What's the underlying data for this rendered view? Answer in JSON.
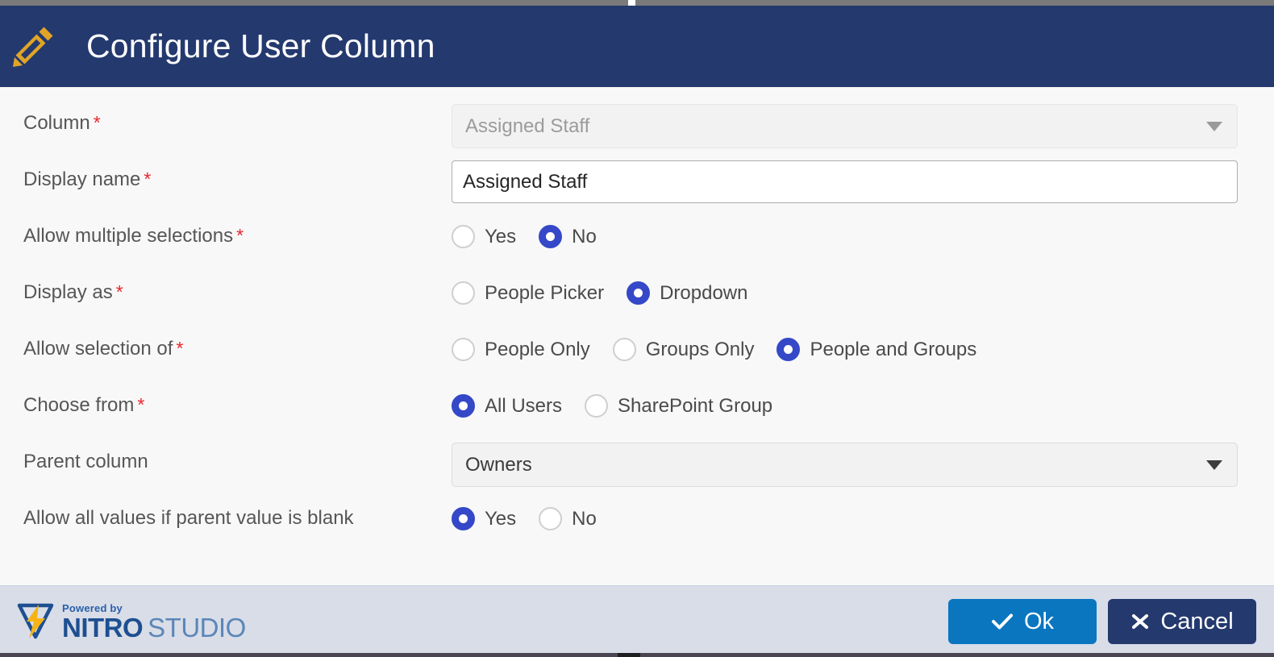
{
  "header": {
    "title": "Configure User Column",
    "icon": "pencil-icon",
    "bg_color": "#24396e",
    "icon_color": "#e0a526"
  },
  "form": {
    "rows": [
      {
        "label": "Column",
        "required": true,
        "control": "select",
        "value": "Assigned Staff",
        "disabled": true
      },
      {
        "label": "Display name",
        "required": true,
        "control": "text",
        "value": "Assigned Staff"
      },
      {
        "label": "Allow multiple selections",
        "required": true,
        "control": "radio",
        "options": [
          {
            "label": "Yes",
            "selected": false
          },
          {
            "label": "No",
            "selected": true
          }
        ]
      },
      {
        "label": "Display as",
        "required": true,
        "control": "radio",
        "options": [
          {
            "label": "People Picker",
            "selected": false
          },
          {
            "label": "Dropdown",
            "selected": true
          }
        ]
      },
      {
        "label": "Allow selection of",
        "required": true,
        "control": "radio",
        "options": [
          {
            "label": "People Only",
            "selected": false
          },
          {
            "label": "Groups Only",
            "selected": false
          },
          {
            "label": "People and Groups",
            "selected": true
          }
        ]
      },
      {
        "label": "Choose from",
        "required": true,
        "control": "radio",
        "options": [
          {
            "label": "All Users",
            "selected": true
          },
          {
            "label": "SharePoint Group",
            "selected": false
          }
        ]
      },
      {
        "label": "Parent column",
        "required": false,
        "control": "select",
        "value": "Owners",
        "disabled": false
      },
      {
        "label": "Allow all values if parent value is blank",
        "required": false,
        "control": "radio",
        "options": [
          {
            "label": "Yes",
            "selected": true
          },
          {
            "label": "No",
            "selected": false
          }
        ]
      }
    ],
    "required_marker": "*",
    "accent_color": "#3448c8",
    "required_color": "#e8262d"
  },
  "footer": {
    "logo": {
      "powered_by": "Powered by",
      "name_bold": "NITRO",
      "name_light": "STUDIO"
    },
    "buttons": [
      {
        "name": "ok-button",
        "label": "Ok",
        "glyph": "check-icon",
        "color": "#0a76c0"
      },
      {
        "name": "cancel-button",
        "label": "Cancel",
        "glyph": "close-icon",
        "color": "#24396e"
      }
    ]
  }
}
